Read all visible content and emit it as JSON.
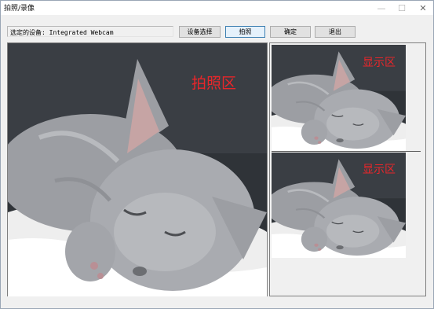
{
  "window": {
    "title": "拍照/录像"
  },
  "titlebar": {
    "minimize_icon": "minimize-icon",
    "maximize_icon": "maximize-icon",
    "close_icon": "close-icon"
  },
  "toolbar": {
    "device_text": "选定的设备: Integrated Webcam",
    "select_device_label": "设备选择",
    "capture_label": "拍照",
    "confirm_label": "确定",
    "exit_label": "退出"
  },
  "capture_panel": {
    "label": "拍照区"
  },
  "display_panels": [
    {
      "label": "显示区"
    },
    {
      "label": "显示区"
    }
  ],
  "colors": {
    "label_red": "#e8262a",
    "focus_border": "#3c7fb1"
  }
}
